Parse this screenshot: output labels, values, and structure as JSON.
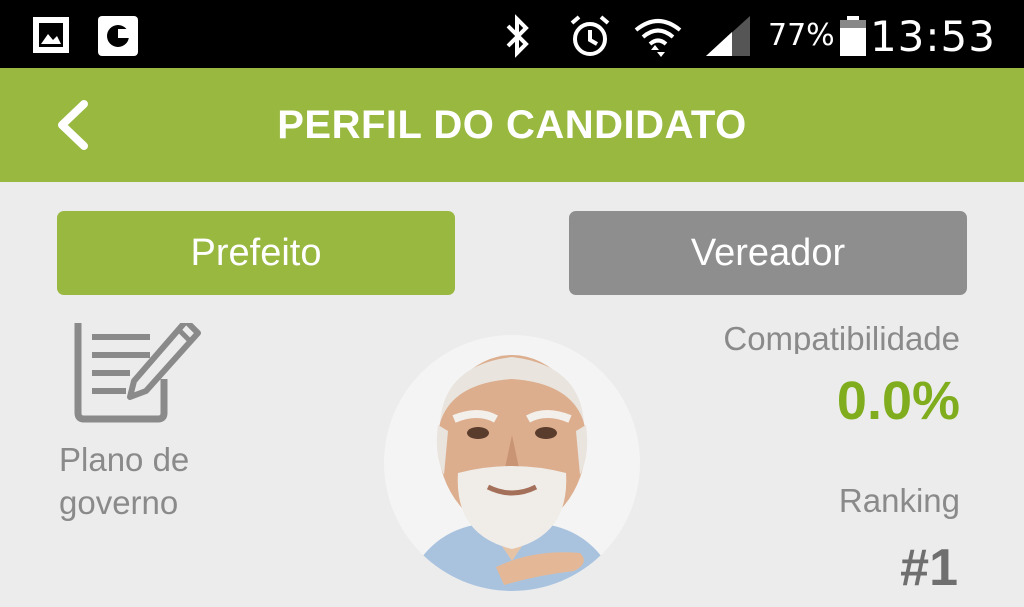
{
  "colors": {
    "brand": "#98b840",
    "value": "#7fad1d",
    "status_bg": "#000000",
    "inactive_button": "#8e8e8e"
  },
  "status_bar": {
    "icons": [
      "gallery-icon",
      "app-c-icon",
      "bluetooth-icon",
      "alarm-icon",
      "wifi-icon",
      "signal-icon",
      "battery-icon"
    ],
    "battery": "77%",
    "time": "13:53"
  },
  "header": {
    "back_icon": "chevron-left-icon",
    "title": "PERFIL DO CANDIDATO"
  },
  "tabs": [
    {
      "label": "Prefeito",
      "active": true
    },
    {
      "label": "Vereador",
      "active": false
    }
  ],
  "plan": {
    "icon": "document-pen-icon",
    "label": "Plano de governo"
  },
  "candidate": {
    "photo": "candidate-photo"
  },
  "stats": {
    "compatibility_label": "Compatibilidade",
    "compatibility_value": "0.0%",
    "ranking_label": "Ranking",
    "ranking_value": "#1"
  }
}
